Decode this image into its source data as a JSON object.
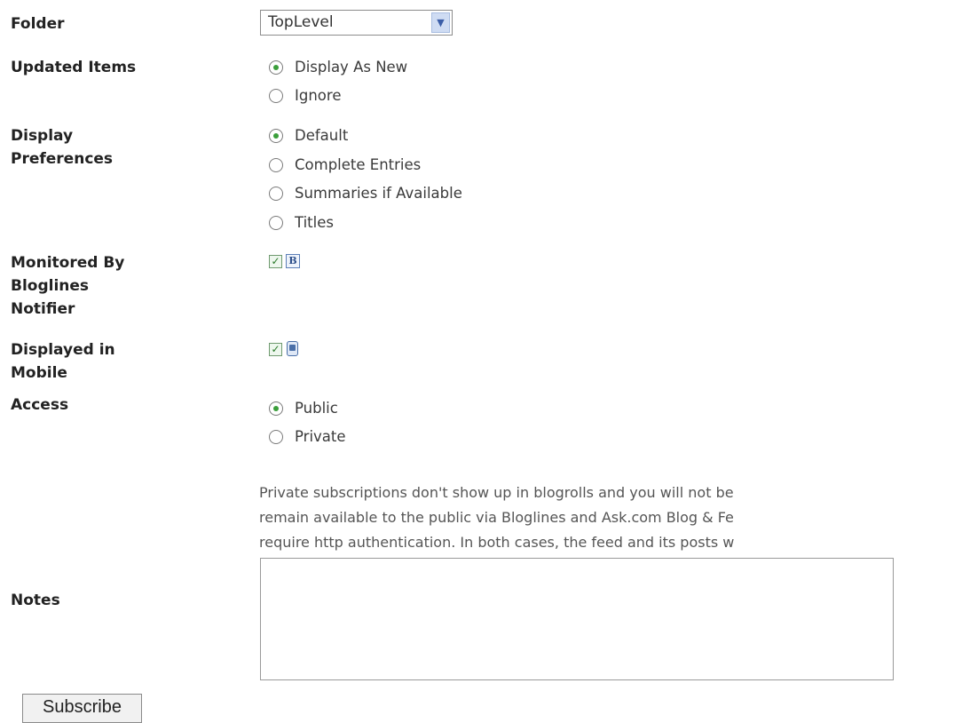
{
  "folder": {
    "label": "Folder",
    "value": "TopLevel"
  },
  "updated_items": {
    "label": "Updated Items",
    "options": [
      "Display As New",
      "Ignore"
    ],
    "selected": "Display As New"
  },
  "display_preferences": {
    "label_line1": "Display",
    "label_line2": "Preferences",
    "options": [
      "Default",
      "Complete Entries",
      "Summaries if Available",
      "Titles"
    ],
    "selected": "Default"
  },
  "monitored": {
    "label_line1": "Monitored By",
    "label_line2": "Bloglines",
    "label_line3": "Notifier",
    "checked": true,
    "icon_letter": "B"
  },
  "mobile": {
    "label_line1": "Displayed in",
    "label_line2": "Mobile",
    "checked": true
  },
  "access": {
    "label": "Access",
    "options": [
      "Public",
      "Private"
    ],
    "selected": "Public",
    "note_lines": [
      "Private subscriptions don't show up in blogrolls and you will not be",
      "remain available to the public via Bloglines and Ask.com Blog & Fe",
      "require http authentication. In both cases, the feed and its posts w"
    ]
  },
  "notes": {
    "label": "Notes",
    "value": ""
  },
  "subscribe_button": {
    "label": "Subscribe"
  },
  "colors": {
    "radio_dot": "#3a9e3a",
    "check": "#2a7a2a",
    "select_arrow": "#3b5ea8"
  }
}
